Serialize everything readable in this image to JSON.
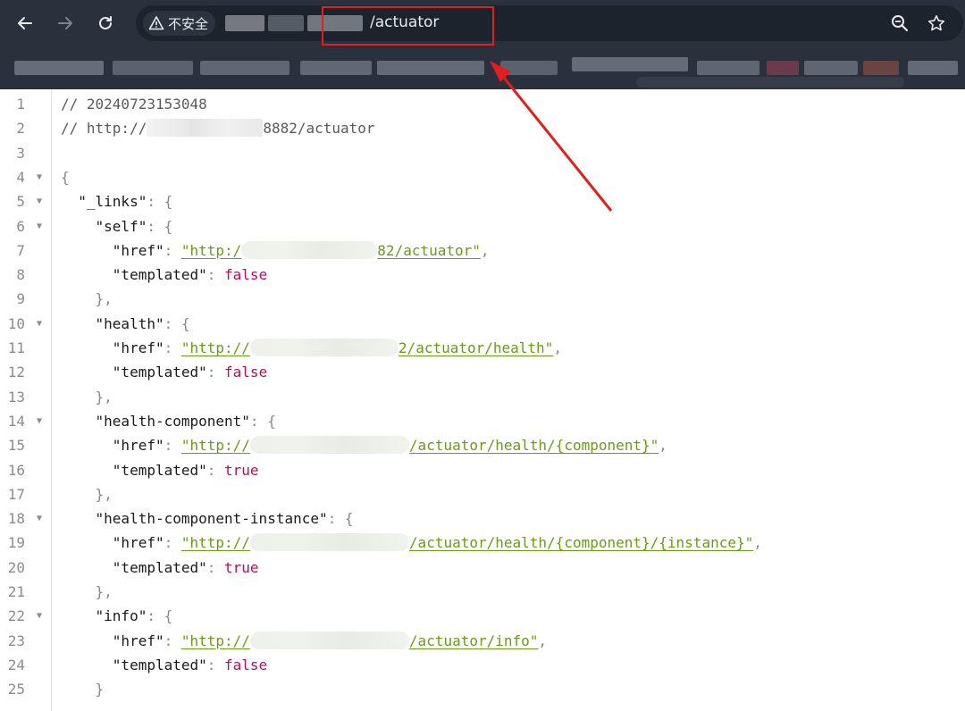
{
  "browser": {
    "back_icon": "arrow-left-icon",
    "forward_icon": "arrow-right-icon",
    "reload_icon": "reload-icon",
    "security_label": "不安全",
    "security_icon": "warning-triangle-icon",
    "url_visible": "/actuator",
    "zoom_icon": "zoom-out-icon",
    "bookmark_icon": "star-icon",
    "annotation_color": "#e02020"
  },
  "viewer": {
    "lines": [
      {
        "n": "1",
        "fold": false,
        "kind": "comment",
        "text": "// 20240723153048"
      },
      {
        "n": "2",
        "fold": false,
        "kind": "comment-url",
        "prefix": "// http://",
        "suffix": "8882/actuator"
      },
      {
        "n": "3",
        "fold": false,
        "kind": "blank"
      },
      {
        "n": "4",
        "fold": true,
        "kind": "open",
        "indent": "",
        "text": "{"
      },
      {
        "n": "5",
        "fold": true,
        "kind": "keyopen",
        "indent": "  ",
        "key": "\"_links\"",
        "text": "{"
      },
      {
        "n": "6",
        "fold": true,
        "kind": "keyopen",
        "indent": "    ",
        "key": "\"self\"",
        "text": "{"
      },
      {
        "n": "7",
        "fold": false,
        "kind": "href",
        "indent": "      ",
        "key": "\"href\"",
        "link_prefix": "\"http:/",
        "link_suffix": "82/actuator\"",
        "blur_width": 152
      },
      {
        "n": "8",
        "fold": false,
        "kind": "bool",
        "indent": "      ",
        "key": "\"templated\"",
        "value": "false"
      },
      {
        "n": "9",
        "fold": false,
        "kind": "close",
        "indent": "    ",
        "text": "},"
      },
      {
        "n": "10",
        "fold": true,
        "kind": "keyopen",
        "indent": "    ",
        "key": "\"health\"",
        "text": "{"
      },
      {
        "n": "11",
        "fold": false,
        "kind": "href",
        "indent": "      ",
        "key": "\"href\"",
        "link_prefix": "\"http://",
        "link_suffix": "2/actuator/health\"",
        "blur_width": 166
      },
      {
        "n": "12",
        "fold": false,
        "kind": "bool",
        "indent": "      ",
        "key": "\"templated\"",
        "value": "false"
      },
      {
        "n": "13",
        "fold": false,
        "kind": "close",
        "indent": "    ",
        "text": "},"
      },
      {
        "n": "14",
        "fold": true,
        "kind": "keyopen",
        "indent": "    ",
        "key": "\"health-component\"",
        "text": "{"
      },
      {
        "n": "15",
        "fold": false,
        "kind": "href",
        "indent": "      ",
        "key": "\"href\"",
        "link_prefix": "\"http://",
        "link_suffix": "/actuator/health/{component}\"",
        "blur_width": 178
      },
      {
        "n": "16",
        "fold": false,
        "kind": "bool",
        "indent": "      ",
        "key": "\"templated\"",
        "value": "true"
      },
      {
        "n": "17",
        "fold": false,
        "kind": "close",
        "indent": "    ",
        "text": "},"
      },
      {
        "n": "18",
        "fold": true,
        "kind": "keyopen",
        "indent": "    ",
        "key": "\"health-component-instance\"",
        "text": "{"
      },
      {
        "n": "19",
        "fold": false,
        "kind": "href",
        "indent": "      ",
        "key": "\"href\"",
        "link_prefix": "\"http://",
        "link_suffix": "/actuator/health/{component}/{instance}\"",
        "blur_width": 178
      },
      {
        "n": "20",
        "fold": false,
        "kind": "bool",
        "indent": "      ",
        "key": "\"templated\"",
        "value": "true"
      },
      {
        "n": "21",
        "fold": false,
        "kind": "close",
        "indent": "    ",
        "text": "},"
      },
      {
        "n": "22",
        "fold": true,
        "kind": "keyopen",
        "indent": "    ",
        "key": "\"info\"",
        "text": "{"
      },
      {
        "n": "23",
        "fold": false,
        "kind": "href",
        "indent": "      ",
        "key": "\"href\"",
        "link_prefix": "\"http://",
        "link_suffix": "/actuator/info\"",
        "blur_width": 178
      },
      {
        "n": "24",
        "fold": false,
        "kind": "bool",
        "indent": "      ",
        "key": "\"templated\"",
        "value": "false"
      },
      {
        "n": "25",
        "fold": false,
        "kind": "close",
        "indent": "    ",
        "text": "}"
      }
    ]
  }
}
